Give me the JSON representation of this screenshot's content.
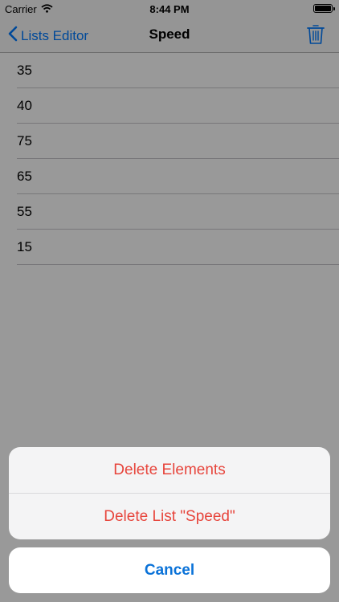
{
  "status_bar": {
    "carrier": "Carrier",
    "time": "8:44 PM",
    "wifi_icon": "wifi-icon",
    "battery_icon": "battery-icon"
  },
  "nav": {
    "back_label": "Lists Editor",
    "back_icon": "chevron-left-icon",
    "title": "Speed",
    "trash_icon": "trash-icon"
  },
  "list": {
    "items": [
      "35",
      "40",
      "75",
      "65",
      "55",
      "15"
    ]
  },
  "action_sheet": {
    "delete_elements_label": "Delete Elements",
    "delete_list_label": "Delete List \"Speed\"",
    "cancel_label": "Cancel"
  },
  "colors": {
    "accent": "#007aff",
    "destructive": "#e7453c",
    "overlay": "rgba(0,0,0,0.4)"
  }
}
